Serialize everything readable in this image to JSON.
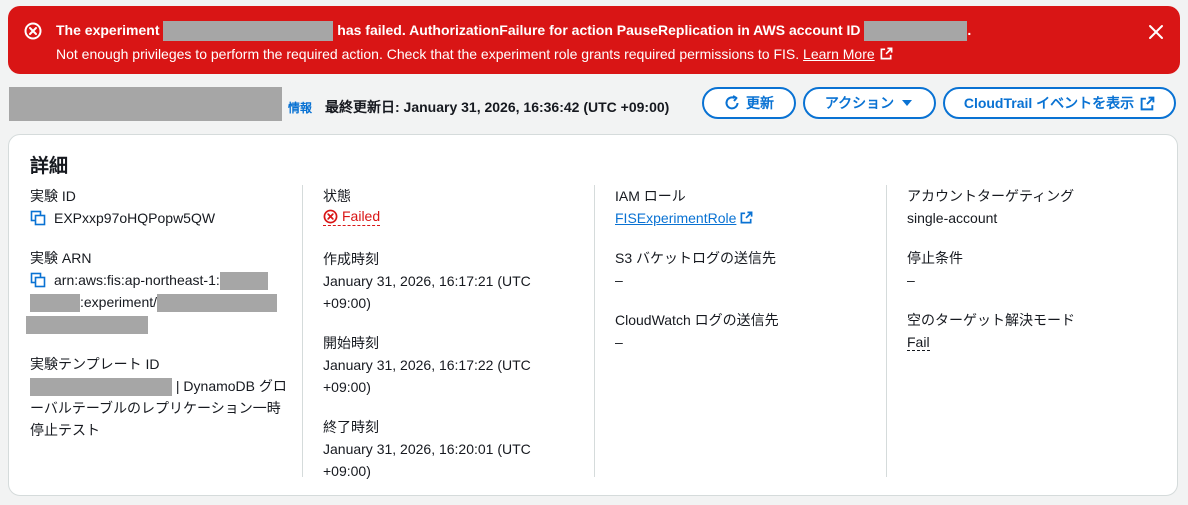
{
  "banner": {
    "line1_pre": "The experiment",
    "line1_mid": "has failed. AuthorizationFailure for action PauseReplication in AWS account ID",
    "line1_end": ".",
    "line2": "Not enough privileges to perform the required action. Check that the experiment role grants required permissions to FIS.",
    "learn_more": "Learn More",
    "color": "#d91515"
  },
  "header": {
    "info": "情報",
    "last_updated": "最終更新日: January 31, 2026, 16:36:42 (UTC +09:00)",
    "refresh_label": "更新",
    "actions_label": "アクション",
    "cloudtrail_label": "CloudTrail イベントを表示"
  },
  "details": {
    "title": "詳細",
    "experiment_id_label": "実験 ID",
    "experiment_id": "EXPxxp97oHQPopw5QW",
    "arn_label": "実験 ARN",
    "arn_prefix": "arn:aws:fis:ap-northeast-1:",
    "arn_mid": ":experiment/",
    "template_label": "実験テンプレート ID",
    "template_suffix": "| DynamoDB グロ",
    "template_line2": "ーバルテーブルのレプリケーション一時",
    "template_line3": "停止テスト",
    "status_label": "状態",
    "status_value": "Failed",
    "created_label": "作成時刻",
    "created_line1": "January 31, 2026, 16:17:21 (UTC",
    "created_line2": "+09:00)",
    "started_label": "開始時刻",
    "started_line1": "January 31, 2026, 16:17:22 (UTC",
    "started_line2": "+09:00)",
    "ended_label": "終了時刻",
    "ended_line1": "January 31, 2026, 16:20:01 (UTC",
    "ended_line2": "+09:00)",
    "iam_role_label": "IAM ロール",
    "iam_role_value": "FISExperimentRole",
    "s3_label": "S3 バケットログの送信先",
    "s3_value": "–",
    "cloudwatch_label": "CloudWatch ログの送信先",
    "cloudwatch_value": "–",
    "account_targeting_label": "アカウントターゲティング",
    "account_targeting_value": "single-account",
    "stop_condition_label": "停止条件",
    "stop_condition_value": "–",
    "empty_target_label": "空のターゲット解決モード",
    "empty_target_value": "Fail"
  },
  "colors": {
    "link": "#0972d3",
    "error": "#d91515",
    "background": "#f2f3f3"
  },
  "icons": [
    "error-circle-icon",
    "close-icon",
    "external-link-icon",
    "refresh-icon",
    "caret-down-icon",
    "copy-icon"
  ]
}
